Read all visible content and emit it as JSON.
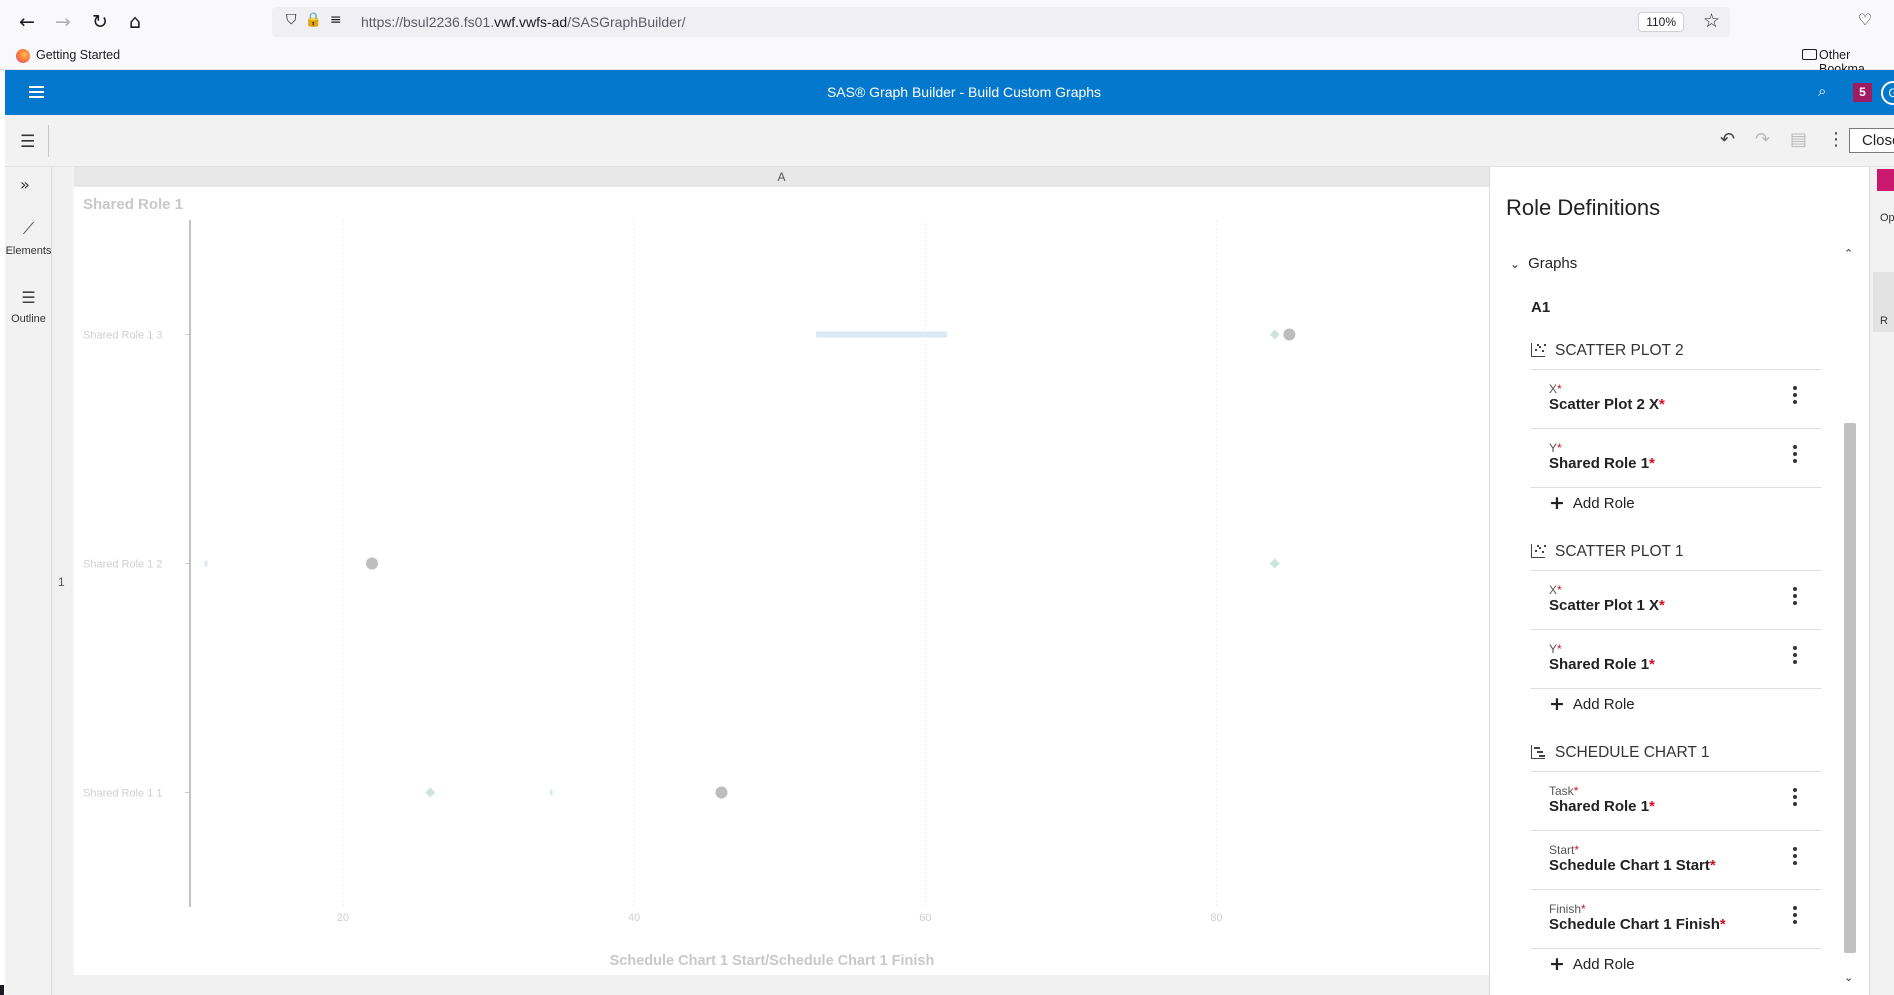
{
  "browser": {
    "url_prefix": "https://bsul2236.fs01.",
    "url_domain": "vwf.vwfs-ad",
    "url_suffix": "/SASGraphBuilder/",
    "zoom": "110%",
    "bookmarks": {
      "getting_started": "Getting Started",
      "other_bookmarks": "Other Bookma"
    }
  },
  "app": {
    "title": "SAS® Graph Builder - Build Custom Graphs",
    "notification_count": "5",
    "avatar_initial": "G",
    "close_label": "Close"
  },
  "left_nav": {
    "items": [
      {
        "label": "Elements",
        "icon": "line-chart-icon"
      },
      {
        "label": "Outline",
        "icon": "list-icon"
      }
    ]
  },
  "canvas": {
    "column_header": "A",
    "row_header": "1"
  },
  "chart_data": {
    "type": "scatter",
    "title": "Shared Role 1",
    "xlabel": "Schedule Chart 1 Start/Schedule Chart 1 Finish",
    "ylabel": "",
    "x_ticks": [
      20,
      40,
      60,
      80
    ],
    "xlim": [
      9.5,
      91.5
    ],
    "y_categories": [
      "Shared Role 1 1",
      "Shared Role 1 2",
      "Shared Role 1 3"
    ],
    "grid": true,
    "series": [
      {
        "kind": "schedule",
        "color": "#dbe9f6",
        "tasks": [
          {
            "category": "Shared Role 1 3",
            "start": 52.5,
            "finish": 61.5
          },
          {
            "category": "Shared Role 1 2",
            "start": 10.5,
            "finish": 10.7
          },
          {
            "category": "Shared Role 1 1",
            "start": 34.2,
            "finish": 34.4
          }
        ]
      },
      {
        "kind": "circle",
        "color": "#bdbdbd",
        "points": [
          {
            "x": 85,
            "y": "Shared Role 1 3"
          },
          {
            "x": 22,
            "y": "Shared Role 1 2"
          },
          {
            "x": 46,
            "y": "Shared Role 1 1"
          }
        ]
      },
      {
        "kind": "diamond",
        "color": "#cde4de",
        "points": [
          {
            "x": 84,
            "y": "Shared Role 1 3"
          },
          {
            "x": 84,
            "y": "Shared Role 1 2"
          },
          {
            "x": 26,
            "y": "Shared Role 1 1"
          }
        ]
      }
    ]
  },
  "role_panel": {
    "title": "Role Definitions",
    "graphs_label": "Graphs",
    "graph_id": "A1",
    "add_role_label": "Add Role",
    "sections": [
      {
        "name": "SCATTER PLOT 2",
        "roles": [
          {
            "label": "X",
            "value": "Scatter Plot 2 X"
          },
          {
            "label": "Y",
            "value": "Shared Role 1"
          }
        ]
      },
      {
        "name": "SCATTER PLOT 1",
        "roles": [
          {
            "label": "X",
            "value": "Scatter Plot 1 X"
          },
          {
            "label": "Y",
            "value": "Shared Role 1"
          }
        ]
      },
      {
        "name": "SCHEDULE CHART 1",
        "roles": [
          {
            "label": "Task",
            "value": "Shared Role 1"
          },
          {
            "label": "Start",
            "value": "Schedule Chart 1 Start"
          },
          {
            "label": "Finish",
            "value": "Schedule Chart 1 Finish"
          }
        ]
      }
    ],
    "required_mark": "*"
  },
  "edge_tabs": {
    "options": "Op",
    "roles": "R"
  }
}
